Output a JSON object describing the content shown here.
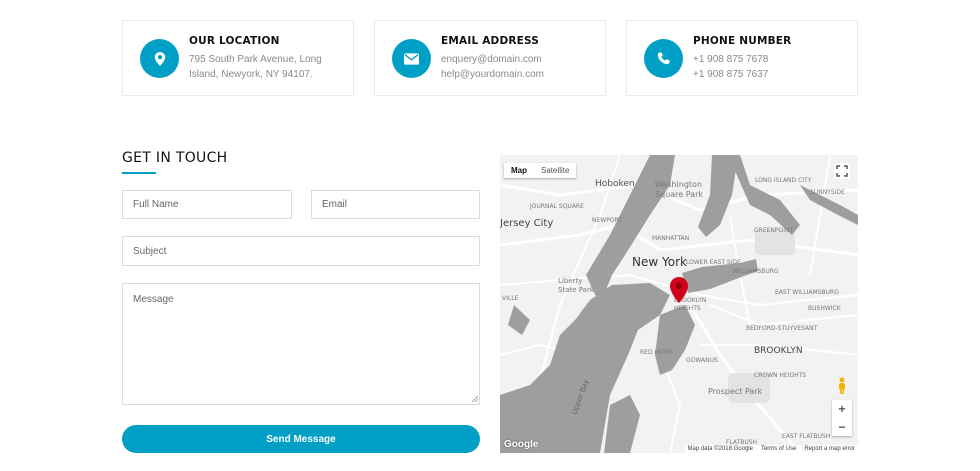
{
  "contact_cards": [
    {
      "icon": "map-marker-icon",
      "title": "OUR LOCATION",
      "line1": "795 South Park Avenue, Long",
      "line2": "Island, Newyork, NY 94107."
    },
    {
      "icon": "envelope-icon",
      "title": "EMAIL ADDRESS",
      "line1": "enquery@domain.com",
      "line2": "help@yourdomain.com"
    },
    {
      "icon": "phone-icon",
      "title": "PHONE NUMBER",
      "line1": "+1 908 875 7678",
      "line2": "+1 908 875 7637"
    }
  ],
  "form": {
    "heading": "GET IN TOUCH",
    "full_name_placeholder": "Full Name",
    "email_placeholder": "Email",
    "subject_placeholder": "Subject",
    "message_placeholder": "Message",
    "submit_label": "Send Message"
  },
  "map": {
    "type_map": "Map",
    "type_satellite": "Satellite",
    "city_label": "New York",
    "labels": {
      "hoboken": "Hoboken",
      "washington_square": "Washington\nSquare Park",
      "jersey_city": "Jersey City",
      "manhattan": "MANHATTAN",
      "williamsburg": "WILLIAMSBURG",
      "brooklyn": "BROOKLYN",
      "bushwick": "BUSHWICK",
      "bedford": "BEDFORD-STUYVESANT",
      "red_hook": "RED HOOK",
      "crown_heights": "CROWN HEIGHTS",
      "prospect_park": "Prospect Park",
      "flatbush": "FLATBUSH",
      "east_flatbush": "EAST FLATBUSH",
      "greenpoint": "GREENPOINT",
      "long_island_city": "LONG ISLAND CITY",
      "sunnyside": "SUNNYSIDE",
      "liberty_state_park": "Liberty\nState Park",
      "upper_bay": "Upper Bay",
      "journal_square": "JOURNAL SQUARE",
      "newport": "NEWPORT",
      "brooklyn_heights": "BROOKLYN\nHEIGHTS",
      "lower_east_side": "LOWER EAST SIDE",
      "gowanus": "GOWANUS",
      "east_williamsburg": "EAST WILLIAMSBURG",
      "ville": "VILLE"
    },
    "google_logo": "Google",
    "attribution": "Map data ©2018 Google",
    "terms": "Terms of Use",
    "report": "Report a map error",
    "zoom_in": "+",
    "zoom_out": "−"
  },
  "colors": {
    "accent": "#00a0c6",
    "water": "#9e9e9e",
    "marker": "#d0021b"
  }
}
